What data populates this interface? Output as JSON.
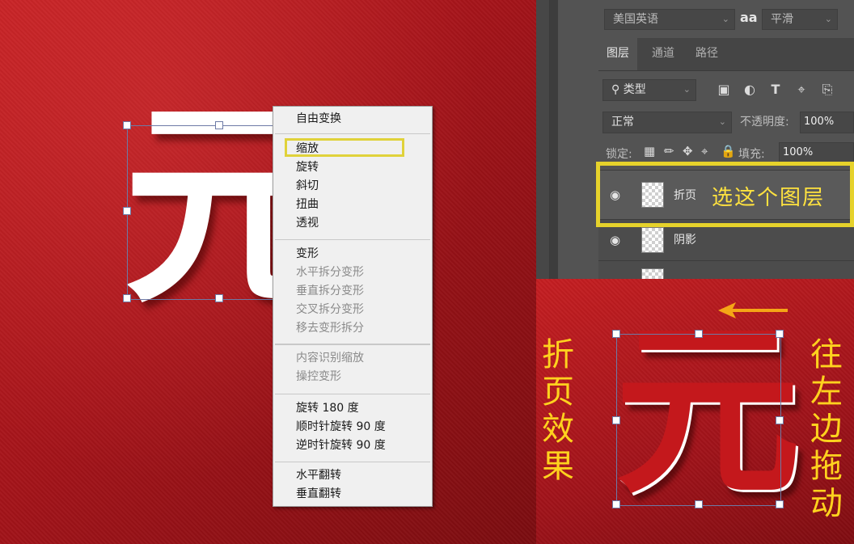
{
  "context_menu": {
    "items": [
      {
        "label": "自由变换",
        "enabled": true
      },
      {
        "label": "缩放",
        "enabled": true,
        "highlighted": true
      },
      {
        "label": "旋转",
        "enabled": true
      },
      {
        "label": "斜切",
        "enabled": true
      },
      {
        "label": "扭曲",
        "enabled": true
      },
      {
        "label": "透视",
        "enabled": true
      },
      {
        "label": "变形",
        "enabled": true
      },
      {
        "label": "水平拆分变形",
        "enabled": false
      },
      {
        "label": "垂直拆分变形",
        "enabled": false
      },
      {
        "label": "交叉拆分变形",
        "enabled": false
      },
      {
        "label": "移去变形拆分",
        "enabled": false
      },
      {
        "label": "内容识别缩放",
        "enabled": false
      },
      {
        "label": "操控变形",
        "enabled": false
      },
      {
        "label": "旋转 180 度",
        "enabled": true
      },
      {
        "label": "顺时针旋转 90 度",
        "enabled": true
      },
      {
        "label": "逆时针旋转 90 度",
        "enabled": true
      },
      {
        "label": "水平翻转",
        "enabled": true
      },
      {
        "label": "垂直翻转",
        "enabled": true
      }
    ]
  },
  "canvas": {
    "glyph": "元"
  },
  "panel": {
    "language": "美国英语",
    "aa_label": "aa",
    "antialias": "平滑",
    "tabs": [
      "图层",
      "通道",
      "路径"
    ],
    "filter_label": "类型",
    "blend_mode": "正常",
    "opacity_label": "不透明度:",
    "opacity_value": "100%",
    "lock_label": "锁定:",
    "fill_label": "填充:",
    "fill_value": "100%",
    "layers": [
      {
        "name": "折页",
        "selected": true
      },
      {
        "name": "阴影",
        "selected": false
      }
    ]
  },
  "annotations": {
    "select_layer": "选这个图层",
    "fold_effect": [
      "折",
      "页",
      "效",
      "果"
    ],
    "drag_left": [
      "往",
      "左",
      "边",
      "拖",
      "动"
    ],
    "arrow_color": "#f5a516",
    "highlight_color": "#e6d22b"
  }
}
